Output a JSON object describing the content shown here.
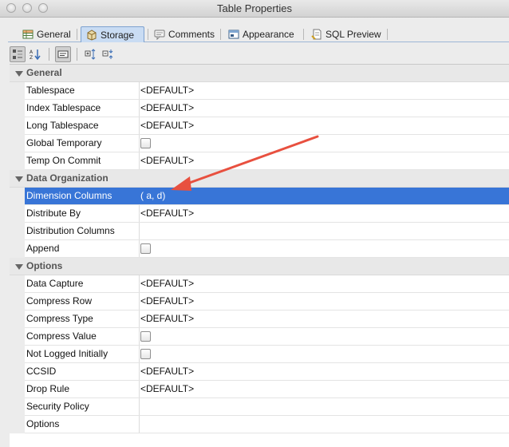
{
  "window": {
    "title": "Table Properties"
  },
  "tabs": [
    {
      "label": "General",
      "icon": "table-grid-icon",
      "active": false
    },
    {
      "label": "Storage",
      "icon": "storage-disk-icon",
      "active": true
    },
    {
      "label": "Comments",
      "icon": "comments-icon",
      "active": false
    },
    {
      "label": "Appearance",
      "icon": "appearance-icon",
      "active": false
    },
    {
      "label": "SQL Preview",
      "icon": "sql-preview-icon",
      "active": false
    }
  ],
  "toolbar": {
    "buttons": [
      "categorized-view-icon",
      "alphabetical-sort-icon",
      "show-description-icon",
      "expand-all-icon",
      "collapse-all-icon"
    ]
  },
  "properties": {
    "general": {
      "label": "General",
      "rows": [
        {
          "name": "Tablespace",
          "value": "<DEFAULT>"
        },
        {
          "name": "Index Tablespace",
          "value": "<DEFAULT>"
        },
        {
          "name": "Long Tablespace",
          "value": "<DEFAULT>"
        },
        {
          "name": "Global Temporary",
          "value": ""
        },
        {
          "name": "Temp On Commit",
          "value": "<DEFAULT>"
        }
      ]
    },
    "data_organization": {
      "label": "Data Organization",
      "rows": [
        {
          "name": "Dimension Columns",
          "value": "( a, d)"
        },
        {
          "name": "Distribute By",
          "value": "<DEFAULT>"
        },
        {
          "name": "Distribution Columns",
          "value": ""
        },
        {
          "name": "Append",
          "value": ""
        }
      ]
    },
    "options": {
      "label": "Options",
      "rows": [
        {
          "name": "Data Capture",
          "value": "<DEFAULT>"
        },
        {
          "name": "Compress Row",
          "value": "<DEFAULT>"
        },
        {
          "name": "Compress Type",
          "value": "<DEFAULT>"
        },
        {
          "name": "Compress Value",
          "value": ""
        },
        {
          "name": "Not Logged Initially",
          "value": ""
        },
        {
          "name": "CCSID",
          "value": "<DEFAULT>"
        },
        {
          "name": "Drop Rule",
          "value": "<DEFAULT>"
        },
        {
          "name": "Security Policy",
          "value": ""
        },
        {
          "name": "Options",
          "value": ""
        }
      ]
    }
  },
  "colors": {
    "selection": "#3875d7",
    "active_tab": "#c9dcf3",
    "annotation_arrow": "#e8503f"
  }
}
